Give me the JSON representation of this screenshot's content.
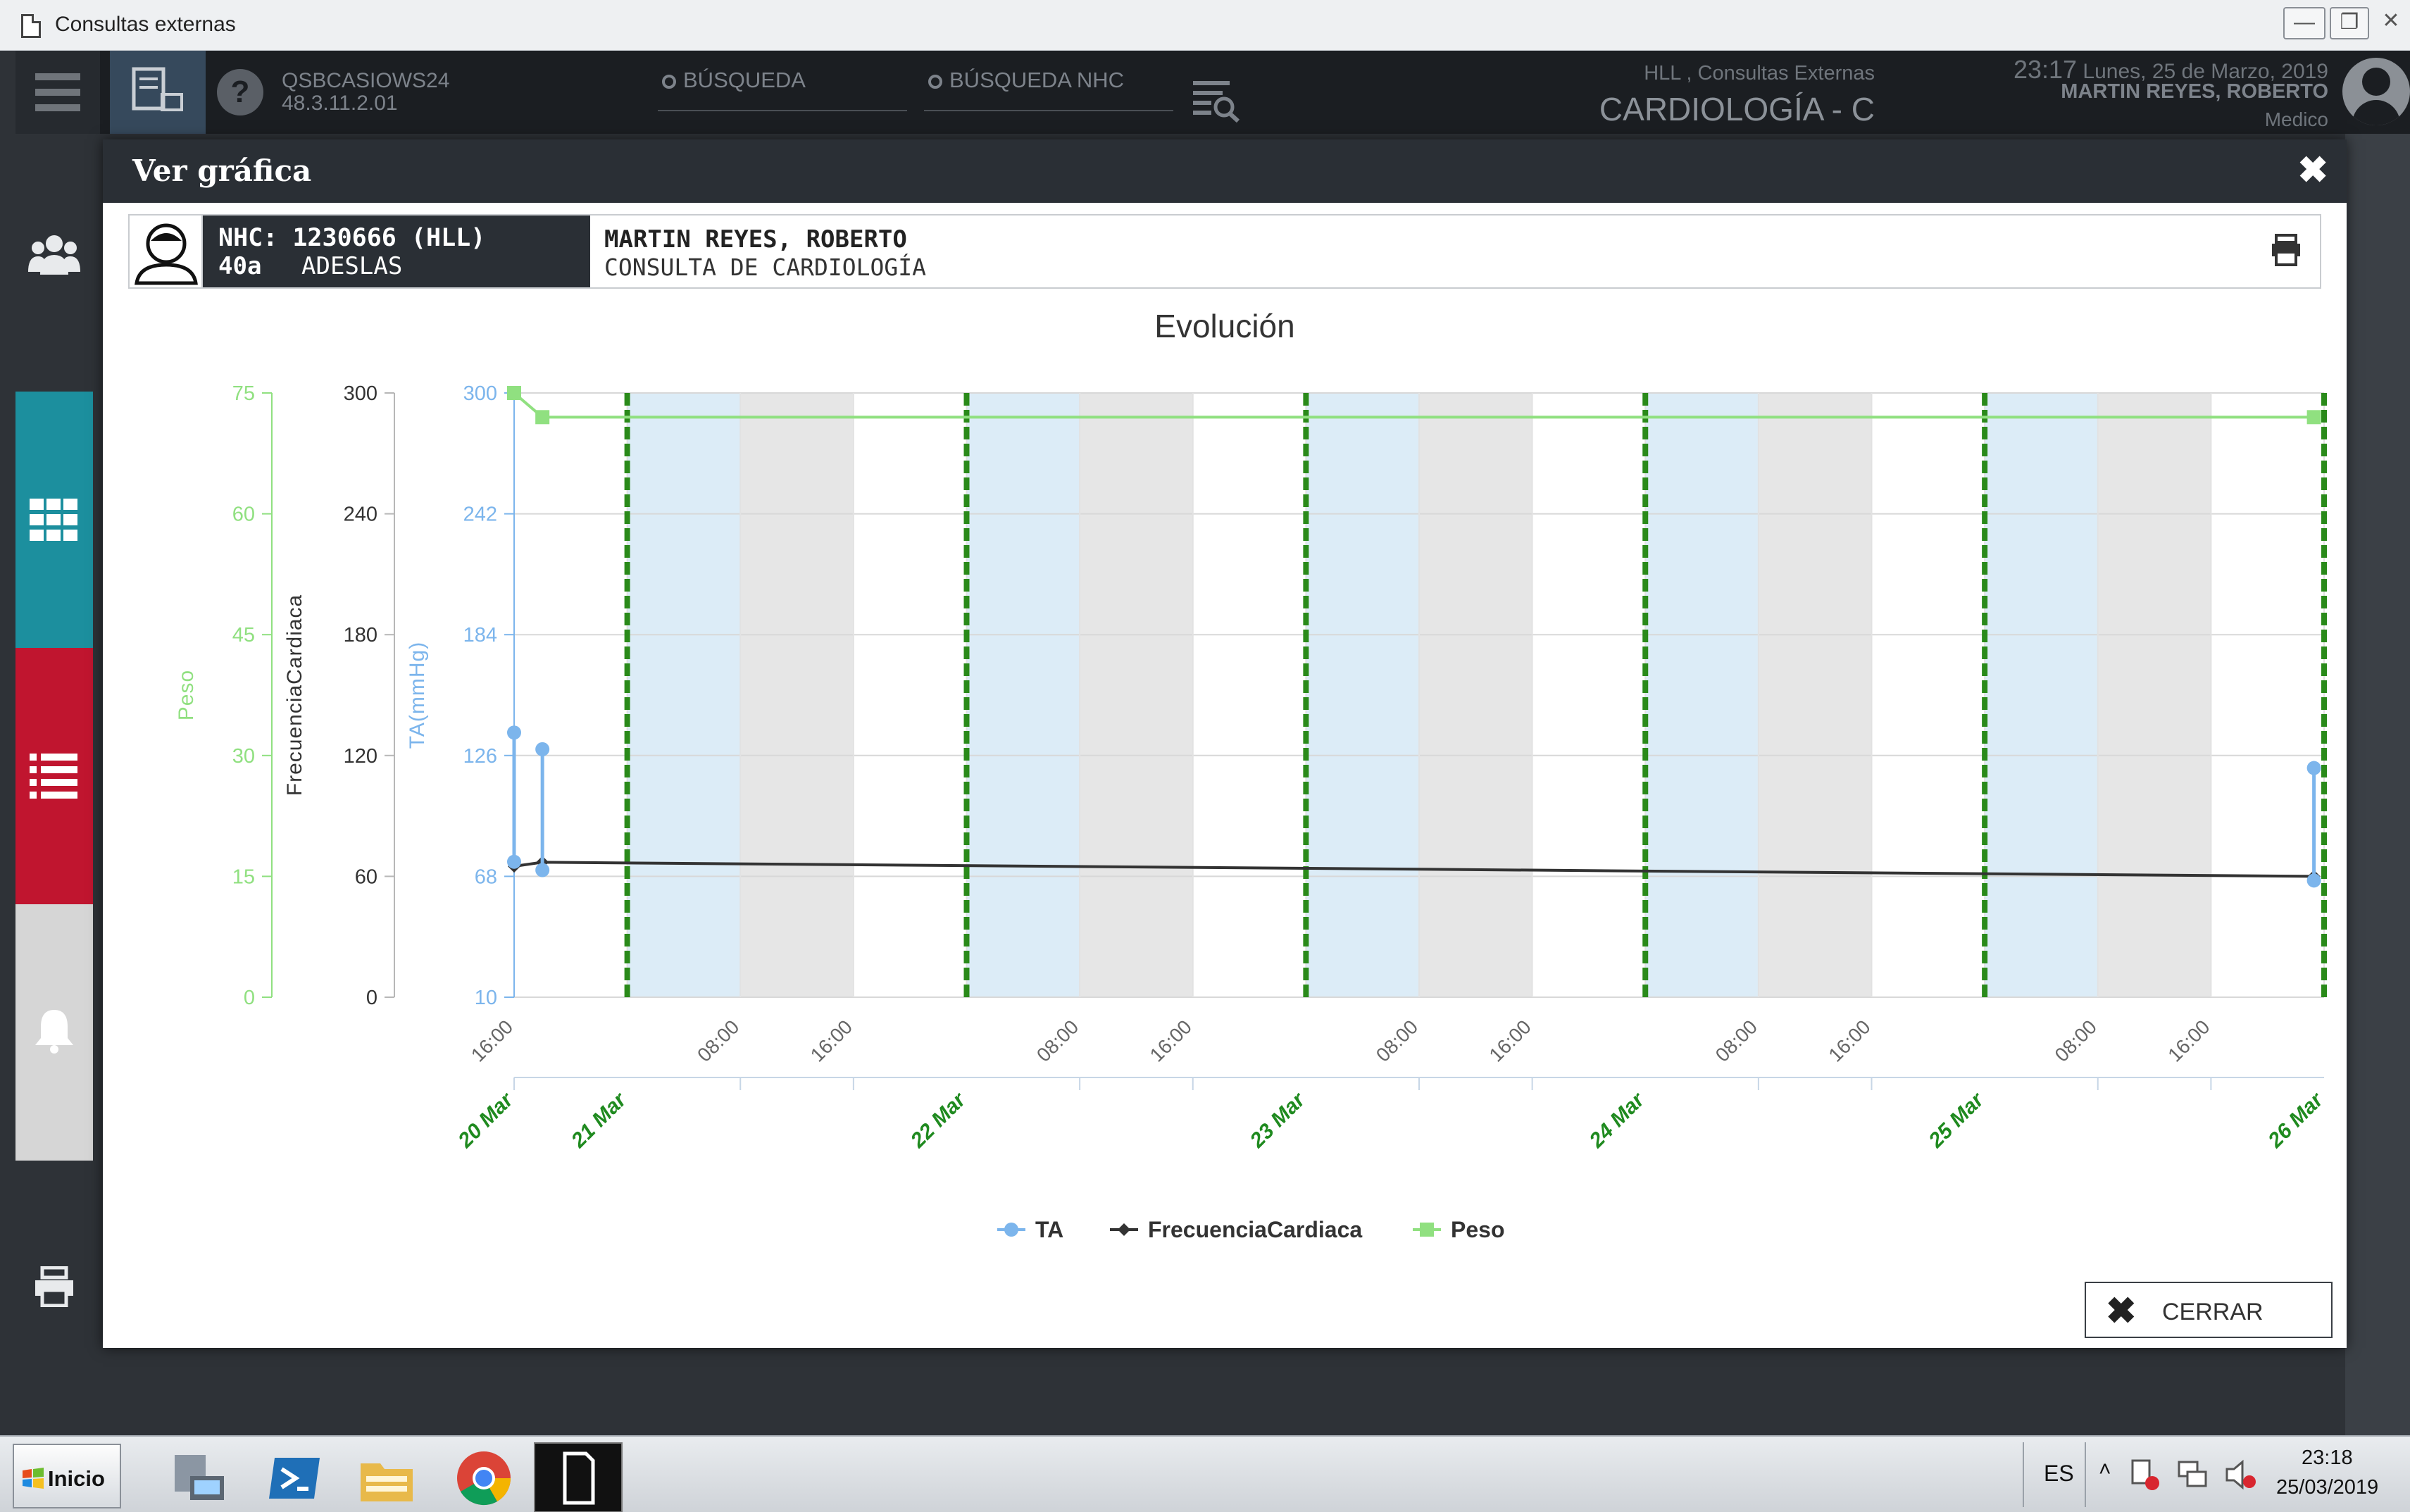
{
  "window": {
    "title": "Consultas externas"
  },
  "header": {
    "server_name": "QSBCASIOWS24",
    "server_ip": "48.3.11.2.01",
    "search_label": "BÚSQUEDA",
    "search_nhc_label": "BÚSQUEDA NHC",
    "hospital": "HLL , Consultas Externas",
    "service": "CARDIOLOGÍA - C",
    "time": "23:17",
    "date": "Lunes, 25 de Marzo, 2019",
    "user": "MARTIN REYES, ROBERTO",
    "role": "Medico"
  },
  "left_nav": {
    "items": [
      {
        "icon": "users-icon",
        "color": "#2e3237"
      },
      {
        "icon": "grid-icon",
        "color": "#1c8f9e"
      },
      {
        "icon": "list-icon",
        "color": "#c0152f"
      },
      {
        "icon": "bell-icon",
        "color": "#d6d6d6"
      },
      {
        "icon": "print-icon",
        "color": "#2e3237"
      }
    ]
  },
  "modal": {
    "title": "Ver gráfica",
    "close_label": "CERRAR"
  },
  "patient": {
    "nhc": "NHC: 1230666 (HLL)",
    "age": "40a",
    "insurer": "ADESLAS",
    "name": "MARTIN REYES, ROBERTO",
    "consultation": "CONSULTA DE CARDIOLOGÍA"
  },
  "chart_data": {
    "type": "line",
    "title": "Evolución",
    "xaxis": {
      "time_ticks": [
        "16:00",
        "08:00",
        "16:00",
        "08:00",
        "16:00",
        "08:00",
        "16:00",
        "08:00",
        "16:00",
        "08:00",
        "16:00"
      ],
      "date_ticks": [
        "20 Mar",
        "21 Mar",
        "22 Mar",
        "23 Mar",
        "24 Mar",
        "25 Mar",
        "26 Mar"
      ],
      "range": [
        "2019-03-20 16:00",
        "2019-03-26 00:00"
      ]
    },
    "yaxes": [
      {
        "label": "Peso",
        "ticks": [
          0,
          15,
          30,
          45,
          60,
          75
        ],
        "range": [
          0,
          75
        ],
        "color": "#90e080"
      },
      {
        "label": "FrecuenciaCardiaca",
        "ticks": [
          0,
          60,
          120,
          180,
          240,
          300
        ],
        "range": [
          0,
          300
        ],
        "color": "#333333"
      },
      {
        "label": "TA(mmHg)",
        "ticks": [
          10,
          68,
          126,
          184,
          242,
          300
        ],
        "range": [
          10,
          300
        ],
        "color": "#7cb5ec"
      }
    ],
    "series": [
      {
        "name": "TA",
        "color": "#7cb5ec",
        "points": [
          {
            "x": "2019-03-20 16:00",
            "low": 75,
            "high": 137
          },
          {
            "x": "2019-03-20 18:00",
            "low": 71,
            "high": 129
          },
          {
            "x": "2019-03-25 23:17",
            "low": 66,
            "high": 120
          }
        ]
      },
      {
        "name": "FrecuenciaCardiaca",
        "color": "#333333",
        "points": [
          {
            "x": "2019-03-20 16:00",
            "y": 65
          },
          {
            "x": "2019-03-20 18:00",
            "y": 67
          },
          {
            "x": "2019-03-25 23:17",
            "y": 60
          }
        ]
      },
      {
        "name": "Peso",
        "color": "#90e080",
        "points": [
          {
            "x": "2019-03-20 16:00",
            "y": 75
          },
          {
            "x": "2019-03-20 18:00",
            "y": 72
          },
          {
            "x": "2019-03-25 23:17",
            "y": 72
          }
        ]
      }
    ],
    "legend": [
      "TA",
      "FrecuenciaCardiaca",
      "Peso"
    ],
    "legend_position": "bottom-center"
  },
  "taskbar": {
    "start_label": "Inicio",
    "lang": "ES",
    "time": "23:18",
    "date": "25/03/2019"
  }
}
